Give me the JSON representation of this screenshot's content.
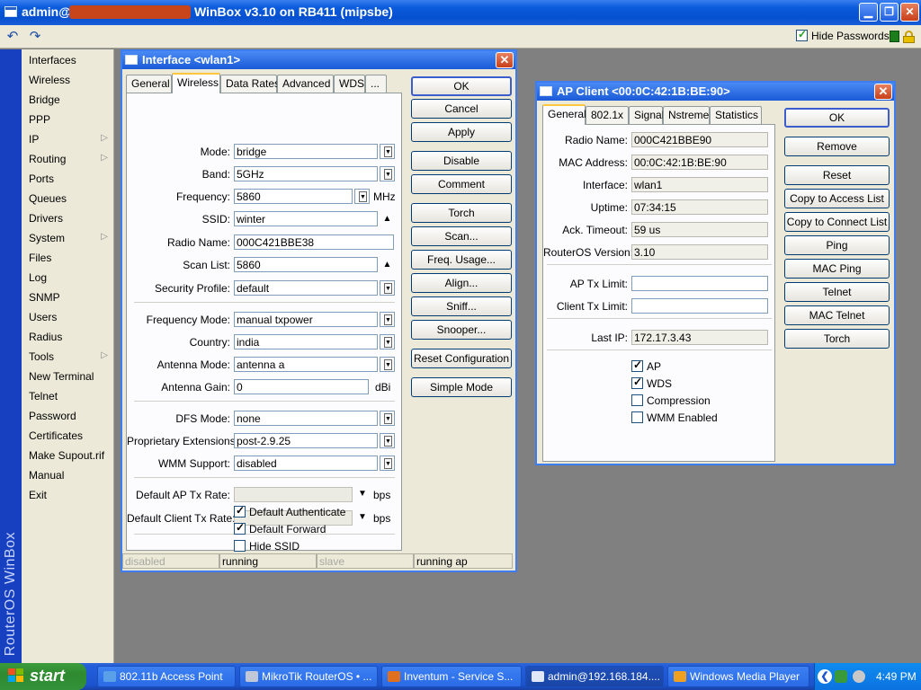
{
  "titlebar": {
    "user": "admin@",
    "title": "WinBox v3.10 on RB411 (mipsbe)"
  },
  "toolbar": {
    "undo": "↶",
    "redo": "↷",
    "hide_passwords": "Hide Passwords"
  },
  "sidebar": {
    "brand": "RouterOS WinBox",
    "items": [
      {
        "label": "Interfaces",
        "sub": false
      },
      {
        "label": "Wireless",
        "sub": false
      },
      {
        "label": "Bridge",
        "sub": false
      },
      {
        "label": "PPP",
        "sub": false
      },
      {
        "label": "IP",
        "sub": true
      },
      {
        "label": "Routing",
        "sub": true
      },
      {
        "label": "Ports",
        "sub": false
      },
      {
        "label": "Queues",
        "sub": false
      },
      {
        "label": "Drivers",
        "sub": false
      },
      {
        "label": "System",
        "sub": true
      },
      {
        "label": "Files",
        "sub": false
      },
      {
        "label": "Log",
        "sub": false
      },
      {
        "label": "SNMP",
        "sub": false
      },
      {
        "label": "Users",
        "sub": false
      },
      {
        "label": "Radius",
        "sub": false
      },
      {
        "label": "Tools",
        "sub": true
      },
      {
        "label": "New Terminal",
        "sub": false
      },
      {
        "label": "Telnet",
        "sub": false
      },
      {
        "label": "Password",
        "sub": false
      },
      {
        "label": "Certificates",
        "sub": false
      },
      {
        "label": "Make Supout.rif",
        "sub": false
      },
      {
        "label": "Manual",
        "sub": false
      },
      {
        "label": "Exit",
        "sub": false
      }
    ]
  },
  "iface": {
    "title": "Interface <wlan1>",
    "tabs": [
      "General",
      "Wireless",
      "Data Rates",
      "Advanced",
      "WDS",
      "..."
    ],
    "fields": {
      "mode": {
        "label": "Mode:",
        "value": "bridge"
      },
      "band": {
        "label": "Band:",
        "value": "5GHz"
      },
      "frequency": {
        "label": "Frequency:",
        "value": "5860",
        "unit": "MHz"
      },
      "ssid": {
        "label": "SSID:",
        "value": "winter"
      },
      "radio_name": {
        "label": "Radio Name:",
        "value": "000C421BBE38"
      },
      "scan_list": {
        "label": "Scan List:",
        "value": "5860"
      },
      "security_profile": {
        "label": "Security Profile:",
        "value": "default"
      },
      "frequency_mode": {
        "label": "Frequency Mode:",
        "value": "manual txpower"
      },
      "country": {
        "label": "Country:",
        "value": "india"
      },
      "antenna_mode": {
        "label": "Antenna Mode:",
        "value": "antenna a"
      },
      "antenna_gain": {
        "label": "Antenna Gain:",
        "value": "0",
        "unit": "dBi"
      },
      "dfs_mode": {
        "label": "DFS Mode:",
        "value": "none"
      },
      "proprietary": {
        "label": "Proprietary Extensions:",
        "value": "post-2.9.25"
      },
      "wmm": {
        "label": "WMM Support:",
        "value": "disabled"
      },
      "ap_tx_rate": {
        "label": "Default AP Tx Rate:",
        "value": "",
        "unit": "bps"
      },
      "client_tx_rate": {
        "label": "Default Client Tx Rate:",
        "value": "",
        "unit": "bps"
      }
    },
    "checks": {
      "default_authenticate": {
        "label": "Default Authenticate",
        "checked": true
      },
      "default_forward": {
        "label": "Default Forward",
        "checked": true
      },
      "hide_ssid": {
        "label": "Hide SSID",
        "checked": false
      }
    },
    "buttons": [
      "OK",
      "Cancel",
      "Apply",
      "Disable",
      "Comment",
      "Torch",
      "Scan...",
      "Freq. Usage...",
      "Align...",
      "Sniff...",
      "Snooper...",
      "Reset Configuration",
      "Simple Mode"
    ],
    "status": [
      "disabled",
      "running",
      "slave",
      "running ap"
    ]
  },
  "apclient": {
    "title": "AP Client <00:0C:42:1B:BE:90>",
    "tabs": [
      "General",
      "802.1x",
      "Signal",
      "Nstreme",
      "Statistics"
    ],
    "fields": {
      "radio_name": {
        "label": "Radio Name:",
        "value": "000C421BBE90"
      },
      "mac": {
        "label": "MAC Address:",
        "value": "00:0C:42:1B:BE:90"
      },
      "interface": {
        "label": "Interface:",
        "value": "wlan1"
      },
      "uptime": {
        "label": "Uptime:",
        "value": "07:34:15"
      },
      "ack_timeout": {
        "label": "Ack. Timeout:",
        "value": "59 us"
      },
      "routeros": {
        "label": "RouterOS Version:",
        "value": "3.10"
      },
      "ap_tx_limit": {
        "label": "AP Tx Limit:",
        "value": ""
      },
      "client_tx_limit": {
        "label": "Client Tx Limit:",
        "value": ""
      },
      "last_ip": {
        "label": "Last IP:",
        "value": "172.17.3.43"
      }
    },
    "checks": {
      "ap": {
        "label": "AP",
        "checked": true
      },
      "wds": {
        "label": "WDS",
        "checked": true
      },
      "compression": {
        "label": "Compression",
        "checked": false
      },
      "wmm": {
        "label": "WMM Enabled",
        "checked": false
      }
    },
    "buttons": [
      "OK",
      "Remove",
      "Reset",
      "Copy to Access List",
      "Copy to Connect List",
      "Ping",
      "MAC Ping",
      "Telnet",
      "MAC Telnet",
      "Torch"
    ]
  },
  "taskbar": {
    "start": "start",
    "tasks": [
      {
        "label": "802.11b Access Point",
        "color": "#5aa0e8"
      },
      {
        "label": "MikroTik RouterOS • ...",
        "color": "#c0c8d8"
      },
      {
        "label": "Inventum - Service S...",
        "color": "#e07020"
      },
      {
        "label": "admin@192.168.184....",
        "color": "#e0e8f8"
      },
      {
        "label": "Windows Media Player",
        "color": "#f0a020"
      }
    ],
    "clock": "4:49 PM"
  }
}
